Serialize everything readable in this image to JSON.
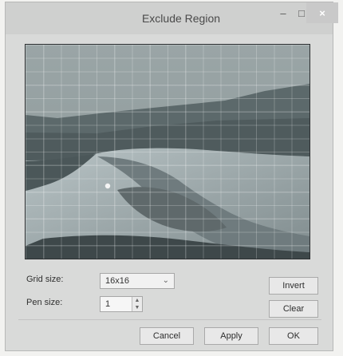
{
  "window": {
    "title": "Exclude Region",
    "min_glyph": "–",
    "max_glyph": "□",
    "close_glyph": "×"
  },
  "controls": {
    "grid_label": "Grid size:",
    "grid_value": "16x16",
    "pen_label": "Pen size:",
    "pen_value": "1"
  },
  "buttons": {
    "invert": "Invert",
    "clear": "Clear",
    "cancel": "Cancel",
    "apply": "Apply",
    "ok": "OK"
  }
}
